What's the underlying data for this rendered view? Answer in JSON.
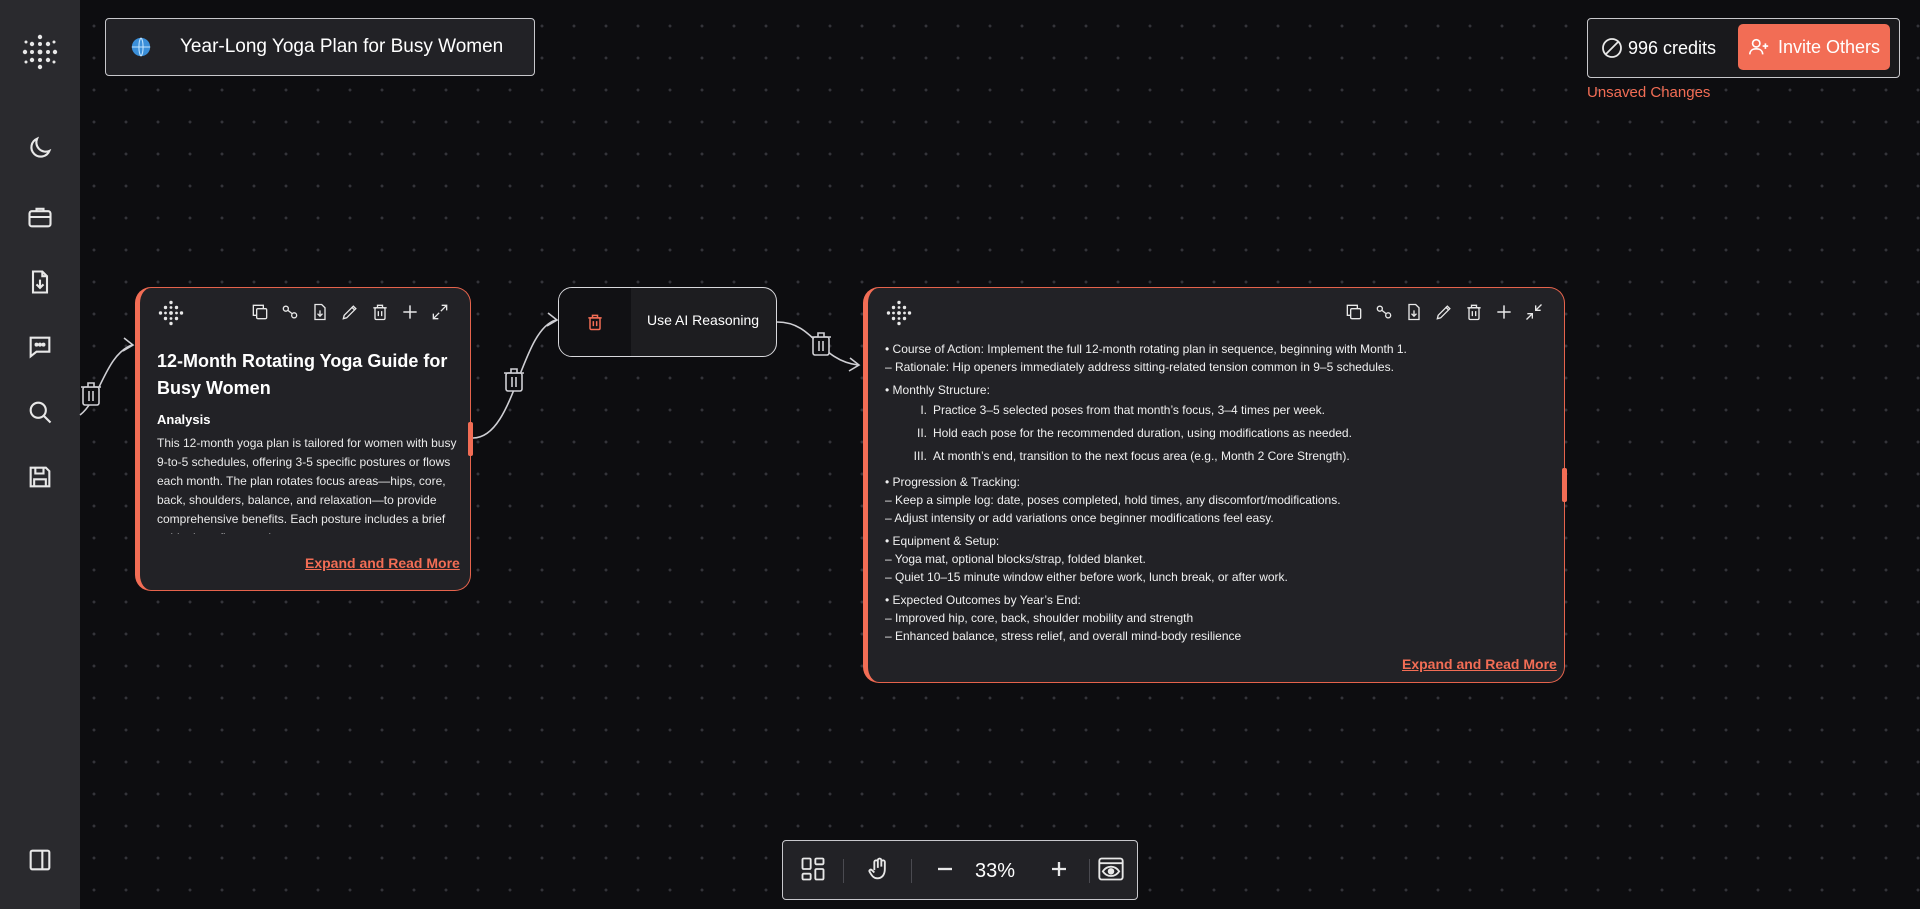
{
  "project": {
    "title": "Year-Long Yoga Plan for Busy Women"
  },
  "header": {
    "credits": "996 credits",
    "invite_label": "Invite Others",
    "unsaved": "Unsaved Changes"
  },
  "sidebar": {
    "icons": [
      "logo-icon",
      "moon-icon",
      "briefcase-icon",
      "file-download-icon",
      "chat-icon",
      "search-icon",
      "save-icon",
      "panel-toggle-icon"
    ]
  },
  "colors": {
    "accent": "#f26d55",
    "background": "#0d0d10",
    "sidebar": "#2a2a2e",
    "card": "#222226"
  },
  "node_analysis": {
    "title": "12-Month Rotating Yoga Guide for Busy Women",
    "subtitle": "Analysis",
    "body": "This 12-month yoga plan is tailored for women with busy 9-to-5 schedules, offering 3-5 specific postures or flows each month. The plan rotates focus areas—hips, core, back, shoulders, balance, and relaxation—to provide comprehensive benefits. Each posture includes a brief guide, benefits, step-by-step",
    "read_more": "Expand and Read More"
  },
  "node_reasoning": {
    "label": "Use AI Reasoning"
  },
  "node_result": {
    "lines": [
      "• Course of Action: Implement the full 12-month rotating plan in sequence, beginning with Month 1.",
      "– Rationale: Hip openers immediately address sitting-related tension common in 9–5 schedules.",
      "• Monthly Structure:"
    ],
    "steps": [
      {
        "num": "I.",
        "text": "Practice 3–5 selected poses from that month’s focus, 3–4 times per week."
      },
      {
        "num": "II.",
        "text": "Hold each pose for the recommended duration, using modifications as needed."
      },
      {
        "num": "III.",
        "text": "At month’s end, transition to the next focus area (e.g., Month 2 Core Strength)."
      }
    ],
    "lines2": [
      "• Progression & Tracking:",
      "– Keep a simple log: date, poses completed, hold times, any discomfort/modifications.",
      "– Adjust intensity or add variations once beginner modifications feel easy.",
      "• Equipment & Setup:",
      "– Yoga mat, optional blocks/strap, folded blanket.",
      "– Quiet 10–15 minute window either before work, lunch break, or after work.",
      "• Expected Outcomes by Year’s End:",
      "– Improved hip, core, back, shoulder mobility and strength",
      "– Enhanced balance, stress relief, and overall mind-body resilience"
    ],
    "read_more": "Expand and Read More"
  },
  "bottom_bar": {
    "zoom": "33%"
  }
}
